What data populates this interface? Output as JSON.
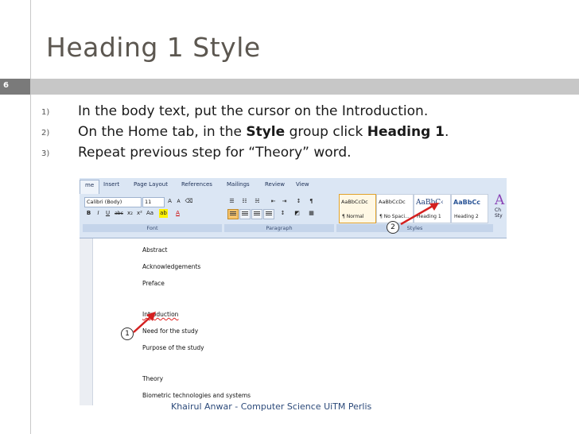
{
  "slide": {
    "title": "Heading 1 Style",
    "number": "6",
    "footer": "Khairul Anwar - Computer Science UiTM Perlis"
  },
  "steps": [
    {
      "index": "1)",
      "text": "In the body text, put the cursor on the Introduction."
    },
    {
      "index": "2)",
      "pre": "On the Home tab, in the ",
      "bold1": "Style",
      "mid": " group click ",
      "bold2": "Heading 1",
      "post": "."
    },
    {
      "index": "3)",
      "text": "Repeat previous step for “Theory” word."
    }
  ],
  "word": {
    "tabs": [
      "me",
      "Insert",
      "Page Layout",
      "References",
      "Mailings",
      "Review",
      "View"
    ],
    "active_tab": "me",
    "font_name": "Calibri (Body)",
    "font_size": "11",
    "groups": {
      "font": "Font",
      "paragraph": "Paragraph",
      "styles": "Styles"
    },
    "style_cards": [
      {
        "preview": "AaBbCcDc",
        "name": "¶ Normal"
      },
      {
        "preview": "AaBbCcDc",
        "name": "¶ No Spaci..."
      },
      {
        "preview": "AaBbC‹",
        "name": "Heading 1"
      },
      {
        "preview": "AaBbCc",
        "name": "Heading 2"
      }
    ],
    "change_styles": {
      "letter": "A",
      "label1": "Ch",
      "label2": "Sty"
    },
    "document_lines": [
      "Abstract",
      "Acknowledgements",
      "Preface",
      "Introduction",
      "Need for the study",
      "Purpose of the study",
      "Theory",
      "Biometric technologies and systems"
    ],
    "callouts": [
      "1",
      "2"
    ]
  },
  "colors": {
    "title": "#5c5750",
    "rule_bar": "#c7c7c7",
    "number_box": "#7a7a7a",
    "arrow": "#d42020",
    "footer": "#2c4a7a"
  }
}
